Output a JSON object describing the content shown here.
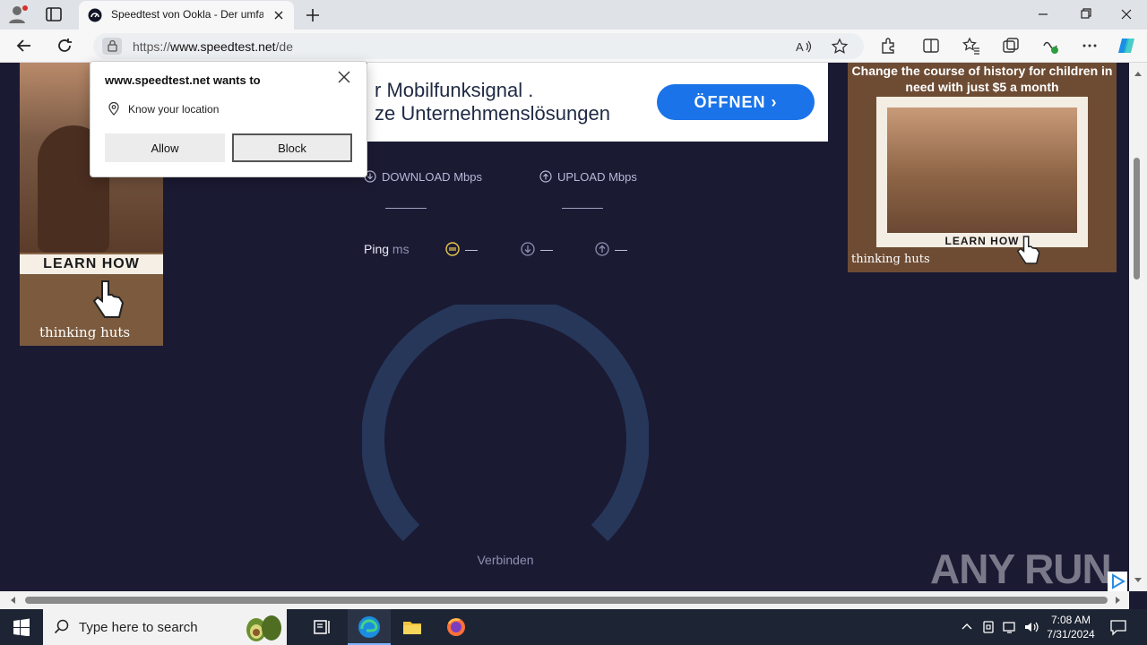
{
  "browser": {
    "tab_title": "Speedtest von Ookla - Der umfassende",
    "url_prefix": "https://",
    "url_domain": "www.speedtest.net",
    "url_path": "/de"
  },
  "permission_popup": {
    "title": "www.speedtest.net wants to",
    "permission": "Know your location",
    "allow_label": "Allow",
    "block_label": "Block"
  },
  "ads": {
    "left_learn": "LEARN HOW",
    "left_brand": "thinking huts",
    "center_line1": "r Mobilfunksignal .",
    "center_line2": "ze Unternehmenslösungen",
    "center_cta": "ÖFFNEN",
    "right_headline": "Change the course of history for children in need with just $5 a month",
    "right_learn": "LEARN HOW",
    "right_brand": "thinking huts"
  },
  "speedtest": {
    "download_label": "DOWNLOAD",
    "download_unit": "Mbps",
    "upload_label": "UPLOAD",
    "upload_unit": "Mbps",
    "ping_label": "Ping",
    "ping_unit": "ms",
    "idle_value": "—",
    "down_value": "—",
    "up_value": "—",
    "status": "Verbinden"
  },
  "watermark": "ANY RUN",
  "taskbar": {
    "search_placeholder": "Type here to search",
    "time": "7:08 AM",
    "date": "7/31/2024"
  },
  "colors": {
    "page_bg": "#1b1a33",
    "gauge": "#26375a",
    "cta_blue": "#1a73e8",
    "ping_yellow": "#e6c84a"
  }
}
